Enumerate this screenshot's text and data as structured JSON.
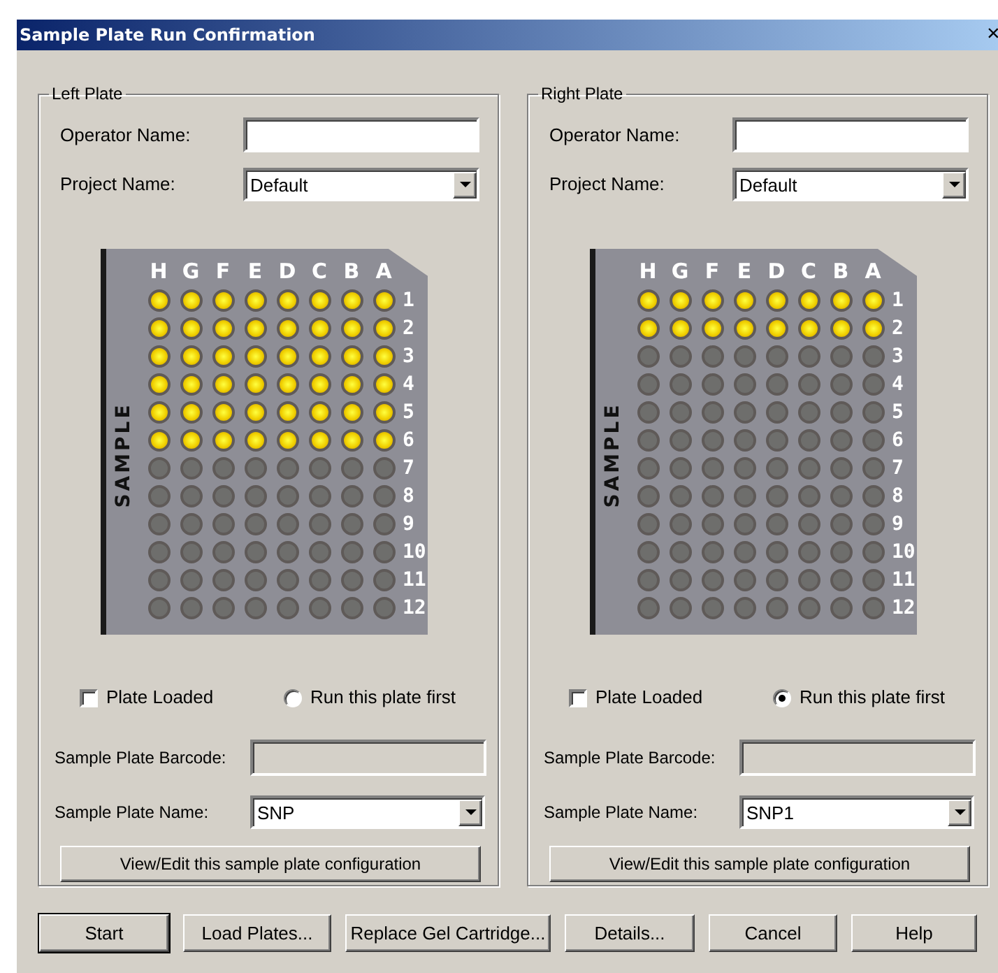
{
  "window": {
    "title": "Sample Plate Run Confirmation",
    "close": "×"
  },
  "plates": [
    {
      "legend": "Left Plate",
      "operator_label": "Operator Name:",
      "project_label": "Project Name:",
      "project_value": "Default",
      "plate_side_label": "SAMPLE",
      "columns": [
        "H",
        "G",
        "F",
        "E",
        "D",
        "C",
        "B",
        "A"
      ],
      "rows": [
        {
          "label": "1",
          "wells": [
            {
              "filled": true
            },
            {
              "filled": true
            },
            {
              "filled": true
            },
            {
              "filled": true
            },
            {
              "filled": true
            },
            {
              "filled": true
            },
            {
              "filled": true
            },
            {
              "filled": true
            }
          ]
        },
        {
          "label": "2",
          "wells": [
            {
              "filled": true
            },
            {
              "filled": true
            },
            {
              "filled": true
            },
            {
              "filled": true
            },
            {
              "filled": true
            },
            {
              "filled": true
            },
            {
              "filled": true
            },
            {
              "filled": true
            }
          ]
        },
        {
          "label": "3",
          "wells": [
            {
              "filled": true
            },
            {
              "filled": true
            },
            {
              "filled": true
            },
            {
              "filled": true
            },
            {
              "filled": true
            },
            {
              "filled": true
            },
            {
              "filled": true
            },
            {
              "filled": true
            }
          ]
        },
        {
          "label": "4",
          "wells": [
            {
              "filled": true
            },
            {
              "filled": true
            },
            {
              "filled": true
            },
            {
              "filled": true
            },
            {
              "filled": true
            },
            {
              "filled": true
            },
            {
              "filled": true
            },
            {
              "filled": true
            }
          ]
        },
        {
          "label": "5",
          "wells": [
            {
              "filled": true
            },
            {
              "filled": true
            },
            {
              "filled": true
            },
            {
              "filled": true
            },
            {
              "filled": true
            },
            {
              "filled": true
            },
            {
              "filled": true
            },
            {
              "filled": true
            }
          ]
        },
        {
          "label": "6",
          "wells": [
            {
              "filled": true
            },
            {
              "filled": true
            },
            {
              "filled": true
            },
            {
              "filled": true
            },
            {
              "filled": true
            },
            {
              "filled": true
            },
            {
              "filled": true
            },
            {
              "filled": true
            }
          ]
        },
        {
          "label": "7",
          "wells": [
            {
              "filled": false
            },
            {
              "filled": false
            },
            {
              "filled": false
            },
            {
              "filled": false
            },
            {
              "filled": false
            },
            {
              "filled": false
            },
            {
              "filled": false
            },
            {
              "filled": false
            }
          ]
        },
        {
          "label": "8",
          "wells": [
            {
              "filled": false
            },
            {
              "filled": false
            },
            {
              "filled": false
            },
            {
              "filled": false
            },
            {
              "filled": false
            },
            {
              "filled": false
            },
            {
              "filled": false
            },
            {
              "filled": false
            }
          ]
        },
        {
          "label": "9",
          "wells": [
            {
              "filled": false
            },
            {
              "filled": false
            },
            {
              "filled": false
            },
            {
              "filled": false
            },
            {
              "filled": false
            },
            {
              "filled": false
            },
            {
              "filled": false
            },
            {
              "filled": false
            }
          ]
        },
        {
          "label": "10",
          "wells": [
            {
              "filled": false
            },
            {
              "filled": false
            },
            {
              "filled": false
            },
            {
              "filled": false
            },
            {
              "filled": false
            },
            {
              "filled": false
            },
            {
              "filled": false
            },
            {
              "filled": false
            }
          ]
        },
        {
          "label": "11",
          "wells": [
            {
              "filled": false
            },
            {
              "filled": false
            },
            {
              "filled": false
            },
            {
              "filled": false
            },
            {
              "filled": false
            },
            {
              "filled": false
            },
            {
              "filled": false
            },
            {
              "filled": false
            }
          ]
        },
        {
          "label": "12",
          "wells": [
            {
              "filled": false
            },
            {
              "filled": false
            },
            {
              "filled": false
            },
            {
              "filled": false
            },
            {
              "filled": false
            },
            {
              "filled": false
            },
            {
              "filled": false
            },
            {
              "filled": false
            }
          ]
        }
      ],
      "plate_loaded": {
        "label": "Plate Loaded",
        "checked": false
      },
      "run_first": {
        "label": "Run this plate first",
        "selected": false
      },
      "barcode_label": "Sample Plate Barcode:",
      "name_label": "Sample Plate Name:",
      "name_value": "SNP",
      "view_button": "View/Edit this sample plate configuration"
    },
    {
      "legend": "Right Plate",
      "operator_label": "Operator Name:",
      "project_label": "Project Name:",
      "project_value": "Default",
      "plate_side_label": "SAMPLE",
      "columns": [
        "H",
        "G",
        "F",
        "E",
        "D",
        "C",
        "B",
        "A"
      ],
      "rows": [
        {
          "label": "1",
          "wells": [
            {
              "filled": true
            },
            {
              "filled": true
            },
            {
              "filled": true
            },
            {
              "filled": true
            },
            {
              "filled": true
            },
            {
              "filled": true
            },
            {
              "filled": true
            },
            {
              "filled": true
            }
          ]
        },
        {
          "label": "2",
          "wells": [
            {
              "filled": true
            },
            {
              "filled": true
            },
            {
              "filled": true
            },
            {
              "filled": true
            },
            {
              "filled": true
            },
            {
              "filled": true
            },
            {
              "filled": true
            },
            {
              "filled": true
            }
          ]
        },
        {
          "label": "3",
          "wells": [
            {
              "filled": false
            },
            {
              "filled": false
            },
            {
              "filled": false
            },
            {
              "filled": false
            },
            {
              "filled": false
            },
            {
              "filled": false
            },
            {
              "filled": false
            },
            {
              "filled": false
            }
          ]
        },
        {
          "label": "4",
          "wells": [
            {
              "filled": false
            },
            {
              "filled": false
            },
            {
              "filled": false
            },
            {
              "filled": false
            },
            {
              "filled": false
            },
            {
              "filled": false
            },
            {
              "filled": false
            },
            {
              "filled": false
            }
          ]
        },
        {
          "label": "5",
          "wells": [
            {
              "filled": false
            },
            {
              "filled": false
            },
            {
              "filled": false
            },
            {
              "filled": false
            },
            {
              "filled": false
            },
            {
              "filled": false
            },
            {
              "filled": false
            },
            {
              "filled": false
            }
          ]
        },
        {
          "label": "6",
          "wells": [
            {
              "filled": false
            },
            {
              "filled": false
            },
            {
              "filled": false
            },
            {
              "filled": false
            },
            {
              "filled": false
            },
            {
              "filled": false
            },
            {
              "filled": false
            },
            {
              "filled": false
            }
          ]
        },
        {
          "label": "7",
          "wells": [
            {
              "filled": false
            },
            {
              "filled": false
            },
            {
              "filled": false
            },
            {
              "filled": false
            },
            {
              "filled": false
            },
            {
              "filled": false
            },
            {
              "filled": false
            },
            {
              "filled": false
            }
          ]
        },
        {
          "label": "8",
          "wells": [
            {
              "filled": false
            },
            {
              "filled": false
            },
            {
              "filled": false
            },
            {
              "filled": false
            },
            {
              "filled": false
            },
            {
              "filled": false
            },
            {
              "filled": false
            },
            {
              "filled": false
            }
          ]
        },
        {
          "label": "9",
          "wells": [
            {
              "filled": false
            },
            {
              "filled": false
            },
            {
              "filled": false
            },
            {
              "filled": false
            },
            {
              "filled": false
            },
            {
              "filled": false
            },
            {
              "filled": false
            },
            {
              "filled": false
            }
          ]
        },
        {
          "label": "10",
          "wells": [
            {
              "filled": false
            },
            {
              "filled": false
            },
            {
              "filled": false
            },
            {
              "filled": false
            },
            {
              "filled": false
            },
            {
              "filled": false
            },
            {
              "filled": false
            },
            {
              "filled": false
            }
          ]
        },
        {
          "label": "11",
          "wells": [
            {
              "filled": false
            },
            {
              "filled": false
            },
            {
              "filled": false
            },
            {
              "filled": false
            },
            {
              "filled": false
            },
            {
              "filled": false
            },
            {
              "filled": false
            },
            {
              "filled": false
            }
          ]
        },
        {
          "label": "12",
          "wells": [
            {
              "filled": false
            },
            {
              "filled": false
            },
            {
              "filled": false
            },
            {
              "filled": false
            },
            {
              "filled": false
            },
            {
              "filled": false
            },
            {
              "filled": false
            },
            {
              "filled": false
            }
          ]
        }
      ],
      "plate_loaded": {
        "label": "Plate Loaded",
        "checked": false
      },
      "run_first": {
        "label": "Run this plate first",
        "selected": true
      },
      "barcode_label": "Sample Plate Barcode:",
      "name_label": "Sample Plate Name:",
      "name_value": "SNP1",
      "view_button": "View/Edit this sample plate configuration"
    }
  ],
  "buttons": [
    "Start",
    "Load Plates...",
    "Replace Gel Cartridge...",
    "Details...",
    "Cancel",
    "Help"
  ]
}
